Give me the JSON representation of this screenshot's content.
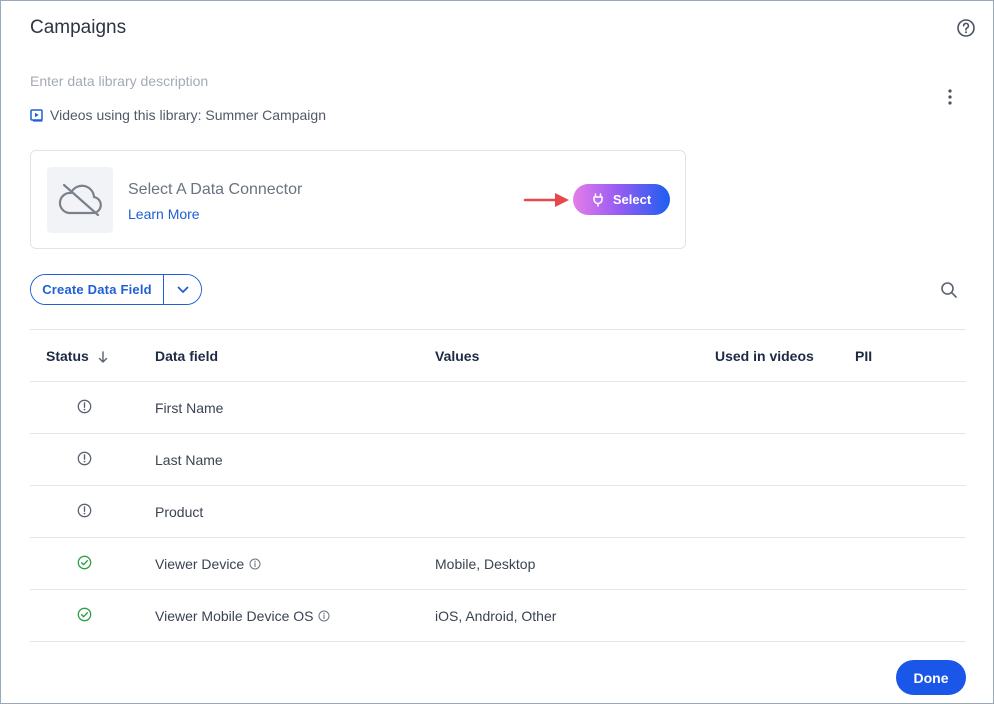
{
  "dialog": {
    "title": "Campaigns",
    "description_placeholder": "Enter data library description",
    "videos_label": "Videos using this library: Summer Campaign"
  },
  "connector": {
    "title": "Select A Data Connector",
    "learn_more": "Learn More",
    "select_label": "Select"
  },
  "toolbar": {
    "create_label": "Create Data Field"
  },
  "table": {
    "headers": {
      "status": "Status",
      "data_field": "Data field",
      "values": "Values",
      "used_in_videos": "Used in videos",
      "pii": "PII"
    },
    "rows": [
      {
        "status": "warning",
        "field": "First Name",
        "info": false,
        "values": ""
      },
      {
        "status": "warning",
        "field": "Last Name",
        "info": false,
        "values": ""
      },
      {
        "status": "warning",
        "field": "Product",
        "info": false,
        "values": ""
      },
      {
        "status": "ok",
        "field": "Viewer Device",
        "info": true,
        "values": "Mobile, Desktop"
      },
      {
        "status": "ok",
        "field": "Viewer Mobile Device OS",
        "info": true,
        "values": "iOS, Android, Other"
      }
    ]
  },
  "footer": {
    "done_label": "Done"
  },
  "colors": {
    "accent": "#1f5fd6",
    "done": "#1a56e8",
    "ok": "#2ea043",
    "warning": "#5a6270",
    "arrow": "#e5484d"
  },
  "icons": [
    "help-icon",
    "kebab-menu-icon",
    "play-icon",
    "cloud-off-icon",
    "plug-icon",
    "chevron-down-icon",
    "search-icon",
    "sort-arrow-icon",
    "warning-circle-icon",
    "check-circle-icon",
    "info-icon"
  ]
}
